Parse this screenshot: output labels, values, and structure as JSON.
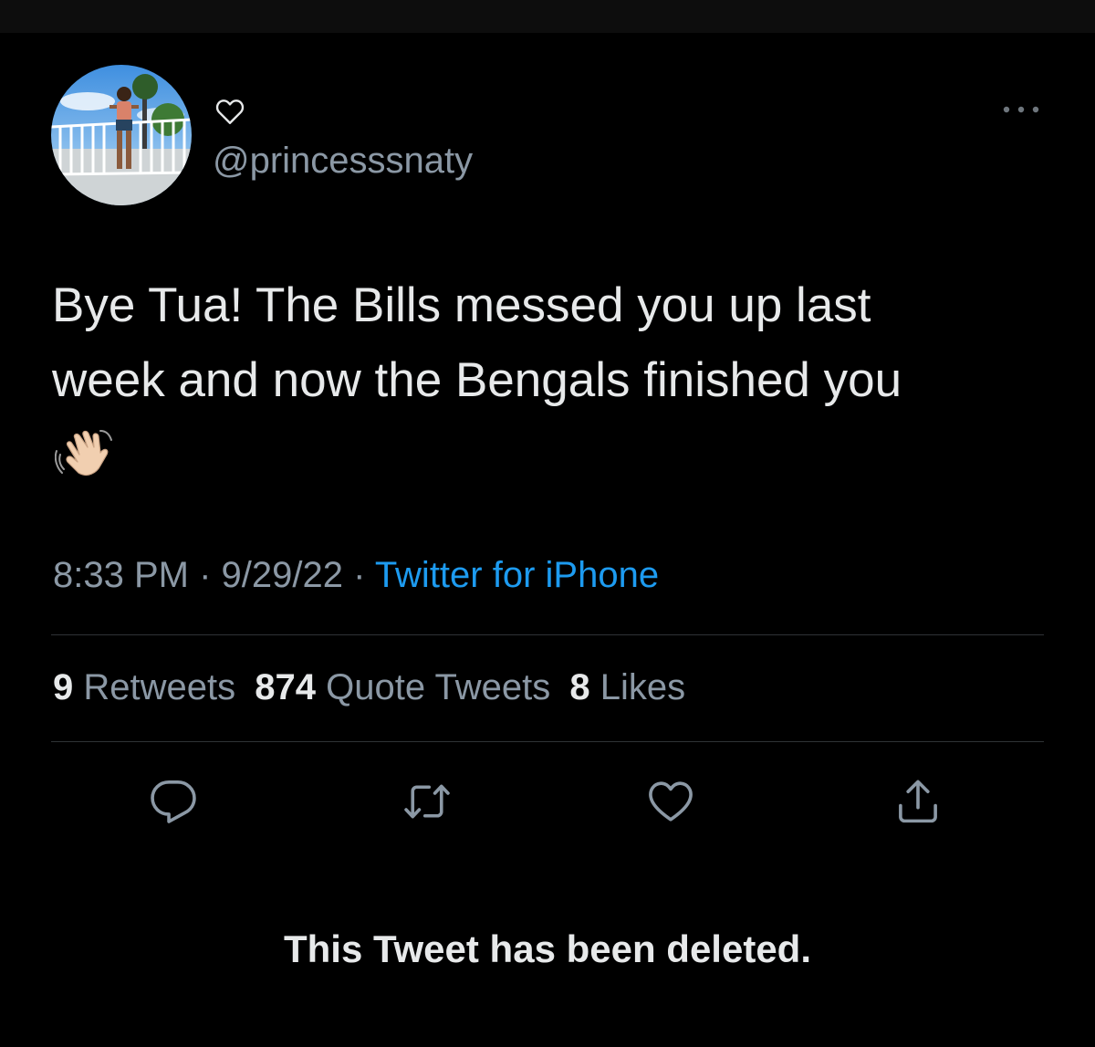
{
  "author": {
    "display_name_icon": "heart-outline-icon",
    "handle": "@princesssnaty"
  },
  "tweet": {
    "text": "Bye Tua! The Bills messed you up last\nweek and now the Bengals finished you",
    "emoji": "waving-hand-emoji",
    "time": "8:33 PM",
    "separator": " · ",
    "date": "9/29/22",
    "source": "Twitter for iPhone"
  },
  "stats": {
    "retweets_count": "9",
    "retweets_label": "Retweets",
    "quote_tweets_count": "874",
    "quote_tweets_label": "Quote Tweets",
    "likes_count": "8",
    "likes_label": "Likes"
  },
  "actions": [
    "reply-icon",
    "retweet-icon",
    "like-icon",
    "share-icon"
  ],
  "more_menu_icon": "more-horizontal-icon",
  "deleted_notice": "This Tweet has been deleted.",
  "colors": {
    "background": "#000000",
    "text_primary": "#e7e9ea",
    "text_secondary": "#8b98a5",
    "link": "#1d9bf0",
    "divider": "#2f3336"
  }
}
